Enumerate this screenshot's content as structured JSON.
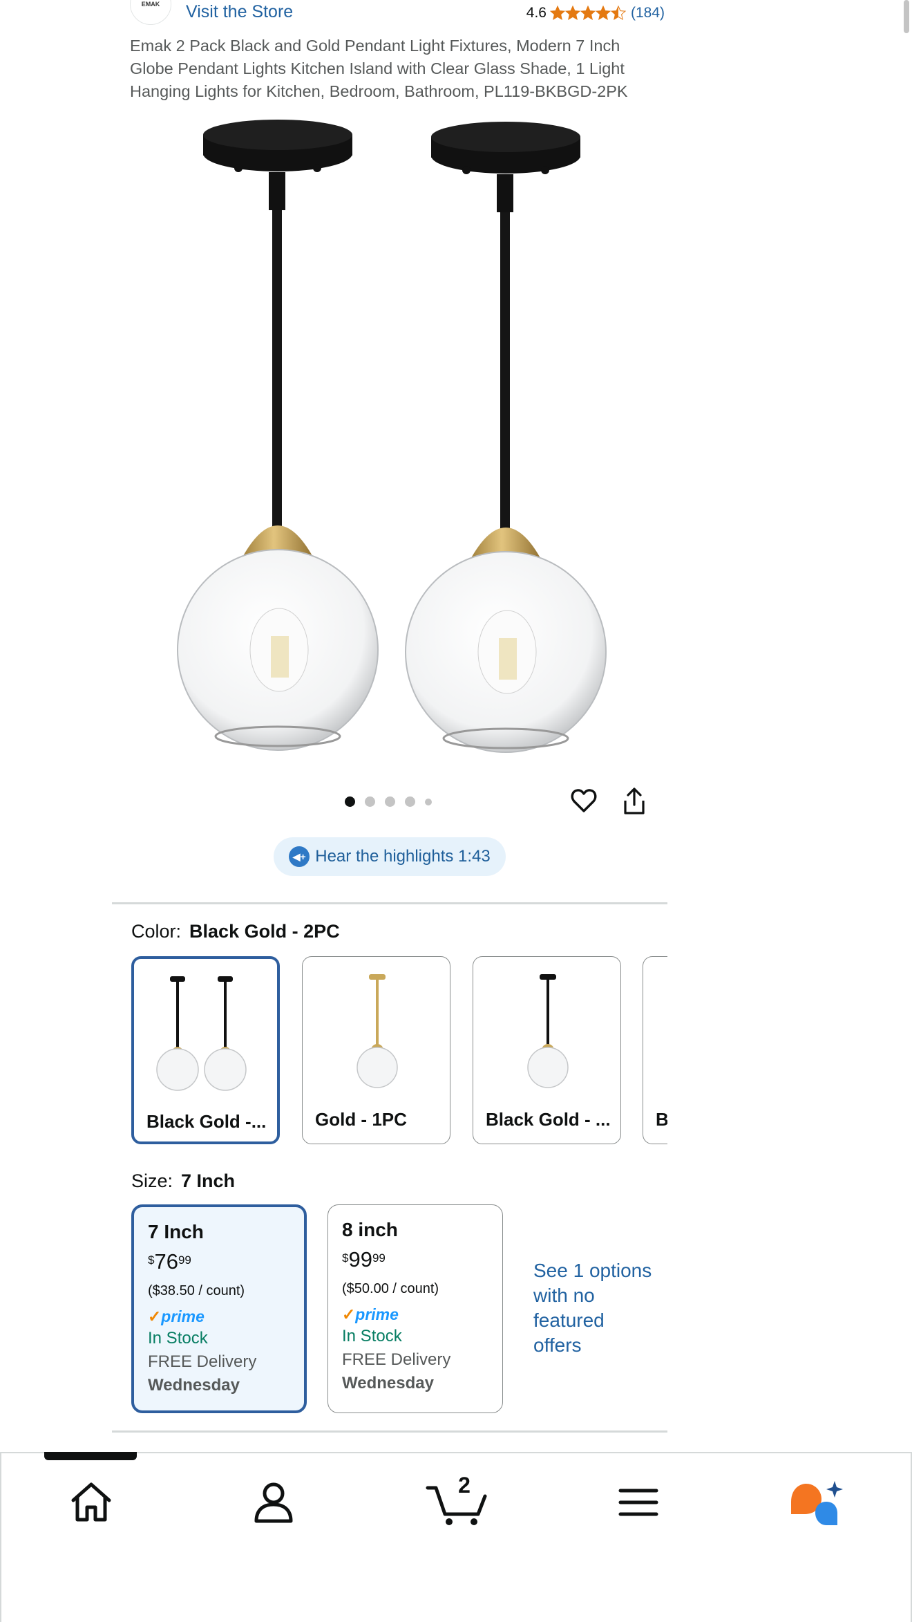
{
  "store": {
    "logo_text": "EMAK",
    "visit_label": "Visit the Store",
    "rating_value": "4.6",
    "rating_stars": 4.5,
    "rating_count": "(184)"
  },
  "product": {
    "title": "Emak 2 Pack Black and Gold Pendant Light Fixtures, Modern 7 Inch Globe Pendant Lights Kitchen Island with Clear Glass Shade, 1 Light Hanging Lights for Kitchen, Bedroom, Bathroom, PL119-BKBGD-2PK"
  },
  "gallery": {
    "image_count": 5,
    "active_index": 0
  },
  "highlights": {
    "label": "Hear the highlights 1:43"
  },
  "color": {
    "label": "Color:",
    "selected": "Black Gold - 2PC",
    "options": [
      {
        "label": "Black Gold -..."
      },
      {
        "label": "Gold - 1PC"
      },
      {
        "label": "Black Gold - ..."
      },
      {
        "label": "B"
      }
    ]
  },
  "size": {
    "label": "Size:",
    "selected": "7 Inch",
    "options": [
      {
        "name": "7 Inch",
        "currency": "$",
        "whole": "76",
        "fraction": "99",
        "unit_price": "($38.50 / count)",
        "prime": "prime",
        "stock": "In Stock",
        "delivery": "FREE Delivery",
        "day": "Wednesday"
      },
      {
        "name": "8 inch",
        "currency": "$",
        "whole": "99",
        "fraction": "99",
        "unit_price": "($50.00 / count)",
        "prime": "prime",
        "stock": "In Stock",
        "delivery": "FREE Delivery",
        "day": "Wednesday"
      }
    ],
    "see_options": "See 1 options with no featured offers"
  },
  "nav": {
    "cart_count": "2",
    "items": [
      "home-icon",
      "account-icon",
      "cart-icon",
      "menu-icon",
      "rufus-icon"
    ]
  },
  "colors": {
    "link": "#2162a1",
    "selected_border": "#2e5e9e",
    "star": "#e47911",
    "in_stock": "#067d62",
    "prime": "#1a98ff"
  }
}
